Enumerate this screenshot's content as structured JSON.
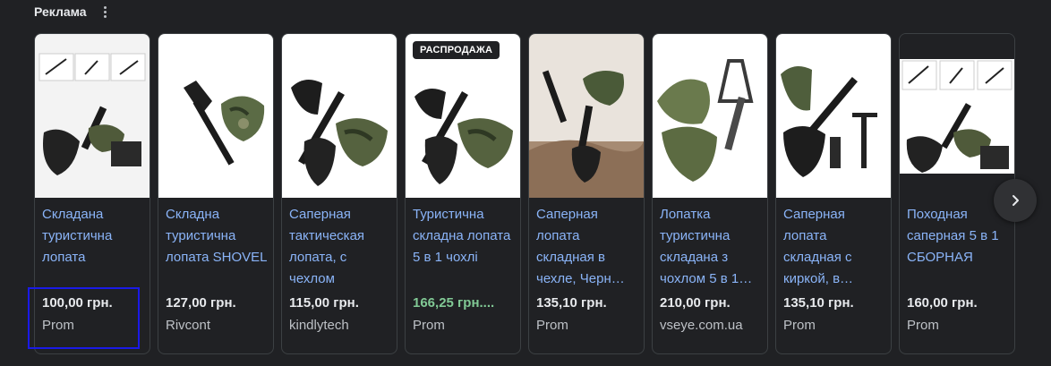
{
  "header": {
    "title": "Реклама",
    "menu_icon": "more-vert-icon"
  },
  "colors": {
    "background": "#202124",
    "title_link": "#8ab4f8",
    "sale_price": "#81c995",
    "card_border": "#3c4043"
  },
  "products": [
    {
      "title": "Складана туристична лопата",
      "price": "100,00 грн.",
      "seller": "Prom",
      "badge": "",
      "image_icon": "folding-shovel-icon"
    },
    {
      "title": "Складна туристична лопата SHOVEL",
      "price": "127,00 грн.",
      "seller": "Rivcont",
      "badge": "",
      "image_icon": "folding-shovel-icon"
    },
    {
      "title": "Саперная тактическая лопата, с чехлом",
      "price": "115,00 грн.",
      "seller": "kindlytech",
      "badge": "",
      "image_icon": "folding-shovel-icon"
    },
    {
      "title": "Туристична складна лопата 5 в 1 чохлі",
      "price": "166,25 грн....",
      "seller": "Prom",
      "badge": "РАСПРОДАЖА",
      "image_icon": "folding-shovel-icon"
    },
    {
      "title": "Саперная лопата складная в чехле, Черн…",
      "price": "135,10 грн.",
      "seller": "Prom",
      "badge": "",
      "image_icon": "folding-shovel-icon"
    },
    {
      "title": "Лопатка туристична складана з чохлом 5 в 1…",
      "price": "210,00 грн.",
      "seller": "vseye.com.ua",
      "badge": "",
      "image_icon": "folding-shovel-icon"
    },
    {
      "title": "Саперная лопата складная с киркой, в…",
      "price": "135,10 грн.",
      "seller": "Prom",
      "badge": "",
      "image_icon": "folding-shovel-icon"
    },
    {
      "title": "Походная саперная 5 в 1 СБОРНАЯ",
      "price": "160,00 грн.",
      "seller": "Prom",
      "badge": "",
      "image_icon": "folding-shovel-icon"
    }
  ],
  "next_button_icon": "chevron-right-icon"
}
